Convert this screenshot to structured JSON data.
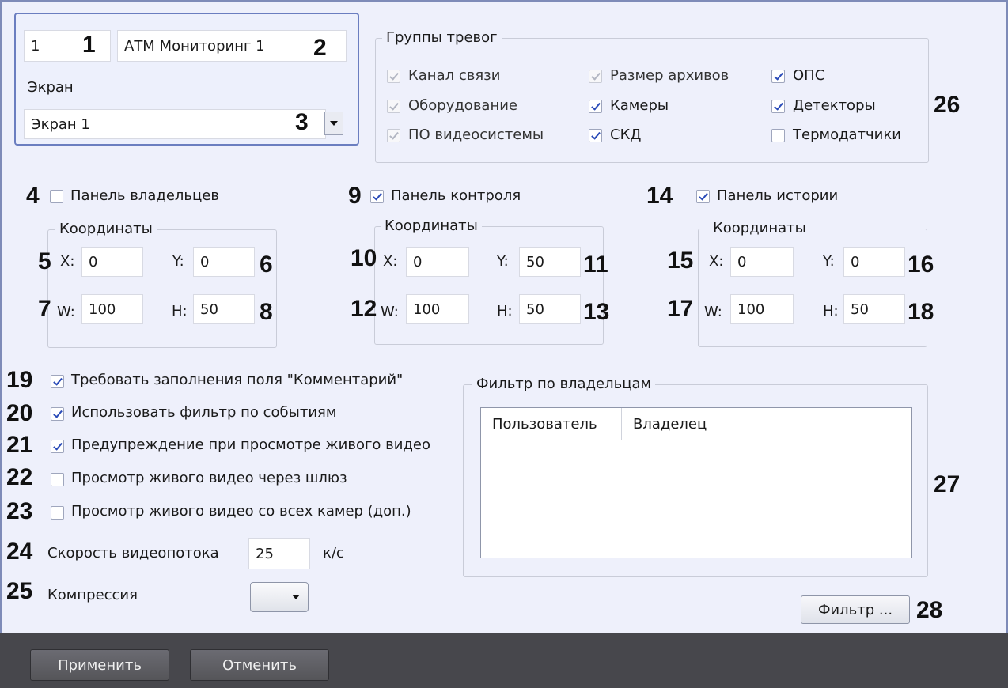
{
  "header": {
    "id_value": "1",
    "id_marker": "1",
    "name_value": "АТМ Мониторинг 1",
    "name_marker": "2",
    "screen_label": "Экран",
    "screen_value": "Экран 1",
    "screen_marker": "3"
  },
  "alarm_groups": {
    "title": "Группы тревог",
    "marker": "26",
    "items": [
      {
        "label": "Канал связи",
        "checked": true,
        "enabled": false
      },
      {
        "label": "Оборудование",
        "checked": true,
        "enabled": false
      },
      {
        "label": "ПО видеосистемы",
        "checked": true,
        "enabled": false
      },
      {
        "label": "Размер архивов",
        "checked": true,
        "enabled": false
      },
      {
        "label": "Камеры",
        "checked": true,
        "enabled": true
      },
      {
        "label": "СКД",
        "checked": true,
        "enabled": true
      },
      {
        "label": "ОПС",
        "checked": true,
        "enabled": true
      },
      {
        "label": "Детекторы",
        "checked": true,
        "enabled": true
      },
      {
        "label": "Термодатчики",
        "checked": false,
        "enabled": true
      }
    ]
  },
  "panels": [
    {
      "marker": "4",
      "label": "Панель владельцев",
      "checked": false,
      "coords_title": "Координаты",
      "x_label": "X:",
      "x_value": "0",
      "x_marker": "5",
      "y_label": "Y:",
      "y_value": "0",
      "y_marker": "6",
      "w_label": "W:",
      "w_value": "100",
      "w_marker": "7",
      "h_label": "H:",
      "h_value": "50",
      "h_marker": "8"
    },
    {
      "marker": "9",
      "label": "Панель контроля",
      "checked": true,
      "coords_title": "Координаты",
      "x_label": "X:",
      "x_value": "0",
      "x_marker": "10",
      "y_label": "Y:",
      "y_value": "50",
      "y_marker": "11",
      "w_label": "W:",
      "w_value": "100",
      "w_marker": "12",
      "h_label": "H:",
      "h_value": "50",
      "h_marker": "13"
    },
    {
      "marker": "14",
      "label": "Панель истории",
      "checked": true,
      "coords_title": "Координаты",
      "x_label": "X:",
      "x_value": "0",
      "x_marker": "15",
      "y_label": "Y:",
      "y_value": "0",
      "y_marker": "16",
      "w_label": "W:",
      "w_value": "100",
      "w_marker": "17",
      "h_label": "H:",
      "h_value": "50",
      "h_marker": "18"
    }
  ],
  "options": [
    {
      "marker": "19",
      "label": "Требовать заполнения поля \"Комментарий\"",
      "checked": true
    },
    {
      "marker": "20",
      "label": "Использовать фильтр по событиям",
      "checked": true
    },
    {
      "marker": "21",
      "label": "Предупреждение при просмотре живого видео",
      "checked": true
    },
    {
      "marker": "22",
      "label": "Просмотр живого видео через шлюз",
      "checked": false
    },
    {
      "marker": "23",
      "label": "Просмотр живого видео со всех камер (доп.)",
      "checked": false
    }
  ],
  "stream": {
    "marker": "24",
    "label": "Скорость видеопотока",
    "value": "25",
    "unit": "к/с"
  },
  "compression": {
    "marker": "25",
    "label": "Компрессия"
  },
  "owner_filter": {
    "title": "Фильтр по владельцам",
    "marker": "27",
    "columns": [
      "Пользователь",
      "Владелец"
    ],
    "button_label": "Фильтр ...",
    "button_marker": "28"
  },
  "footer": {
    "apply_label": "Применить",
    "cancel_label": "Отменить"
  },
  "colors": {
    "accent": "#2a4bb8",
    "frame_border": "#6b7ec0",
    "footer_bg": "#47474c"
  }
}
